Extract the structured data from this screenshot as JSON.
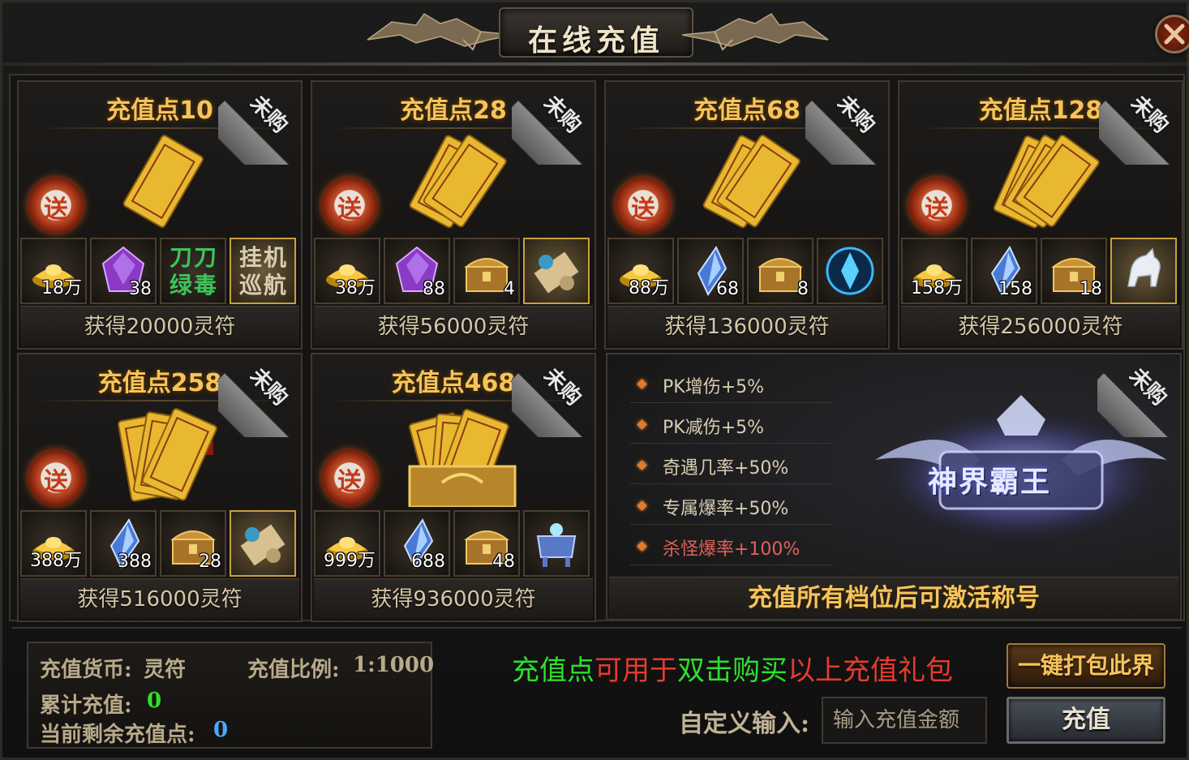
{
  "window": {
    "title": "在线充值",
    "close_icon": "close-icon"
  },
  "packages": [
    {
      "title": "充值点10",
      "status": "未购",
      "gift_badge": "送",
      "hero": "gold-ticket-single",
      "items": [
        {
          "icon": "gold-ingot-icon",
          "qty": "18万"
        },
        {
          "icon": "purple-gem-icon",
          "qty": "38"
        },
        {
          "icon": "text",
          "text": "刀刀绿毒",
          "lines": [
            "刀刀",
            "绿毒"
          ],
          "color": "#3ec45a"
        },
        {
          "icon": "text",
          "text": "挂机巡航",
          "lines": [
            "挂机",
            "巡航"
          ],
          "color": "#d8ccb0",
          "gold_frame": true
        }
      ],
      "reward": "获得20000灵符"
    },
    {
      "title": "充值点28",
      "status": "未购",
      "gift_badge": "送",
      "hero": "gold-ticket-pair",
      "items": [
        {
          "icon": "gold-ingot-icon",
          "qty": "38万"
        },
        {
          "icon": "purple-gem-icon",
          "qty": "88"
        },
        {
          "icon": "treasure-chest-icon",
          "qty": "4"
        },
        {
          "icon": "scroll-icon",
          "qty": "",
          "gold_frame": true
        }
      ],
      "reward": "获得56000灵符"
    },
    {
      "title": "充值点68",
      "status": "未购",
      "gift_badge": "送",
      "hero": "gold-ticket-pair",
      "items": [
        {
          "icon": "gold-ingot-icon",
          "qty": "88万"
        },
        {
          "icon": "blue-crystal-icon",
          "qty": "68"
        },
        {
          "icon": "treasure-chest-icon",
          "qty": "8"
        },
        {
          "icon": "blue-emblem-icon",
          "qty": ""
        }
      ],
      "reward": "获得136000灵符"
    },
    {
      "title": "充值点128",
      "status": "未购",
      "gift_badge": "送",
      "hero": "gold-ticket-triple",
      "items": [
        {
          "icon": "gold-ingot-icon",
          "qty": "158万"
        },
        {
          "icon": "blue-crystal-icon",
          "qty": "158"
        },
        {
          "icon": "treasure-chest-icon",
          "qty": "18"
        },
        {
          "icon": "white-horse-icon",
          "qty": "",
          "gold_frame": true
        }
      ],
      "reward": "获得256000灵符"
    },
    {
      "title": "充值点258",
      "status": "未购",
      "gift_badge": "送",
      "hero": "gold-ticket-bundle",
      "items": [
        {
          "icon": "gold-ingot-icon",
          "qty": "388万"
        },
        {
          "icon": "blue-crystal-icon",
          "qty": "388"
        },
        {
          "icon": "treasure-chest-icon",
          "qty": "28"
        },
        {
          "icon": "scroll-icon",
          "qty": "",
          "gold_frame": true
        }
      ],
      "reward": "获得516000灵符"
    },
    {
      "title": "充值点468",
      "status": "未购",
      "gift_badge": "送",
      "hero": "gold-ticket-chest",
      "items": [
        {
          "icon": "gold-ingot-icon",
          "qty": "999万"
        },
        {
          "icon": "blue-crystal-icon",
          "qty": "688"
        },
        {
          "icon": "treasure-chest-icon",
          "qty": "48"
        },
        {
          "icon": "blue-cauldron-icon",
          "qty": ""
        }
      ],
      "reward": "获得936000灵符"
    }
  ],
  "title_panel": {
    "status": "未购",
    "bonuses": [
      {
        "text": "PK增伤+5%",
        "highlight": false
      },
      {
        "text": "PK减伤+5%",
        "highlight": false
      },
      {
        "text": "奇遇几率+50%",
        "highlight": false
      },
      {
        "text": "专属爆率+50%",
        "highlight": false
      },
      {
        "text": "杀怪爆率+100%",
        "highlight": true
      }
    ],
    "emblem_text": "神界霸王",
    "activate_text": "充值所有档位后可激活称号"
  },
  "footer": {
    "currency_label": "充值货币:",
    "currency_value": "灵符",
    "ratio_label": "充值比例:",
    "ratio_value": "1:1000",
    "total_label": "累计充值:",
    "total_value": "0",
    "remaining_label": "当前剩余充值点:",
    "remaining_value": "0",
    "promo": {
      "part1": "充值点",
      "part2": "可用于",
      "part3": "双击购买",
      "part4": "以上",
      "part5": "充值礼包"
    },
    "pack_button": "一键打包此界面",
    "custom_label": "自定义输入:",
    "input_placeholder": "输入充值金额",
    "recharge_button": "充值"
  },
  "colors": {
    "gold_title": "#f4c45c",
    "promo_green": "#2ee02e",
    "promo_red": "#e83a30",
    "value_blue": "#4aa8ff"
  }
}
